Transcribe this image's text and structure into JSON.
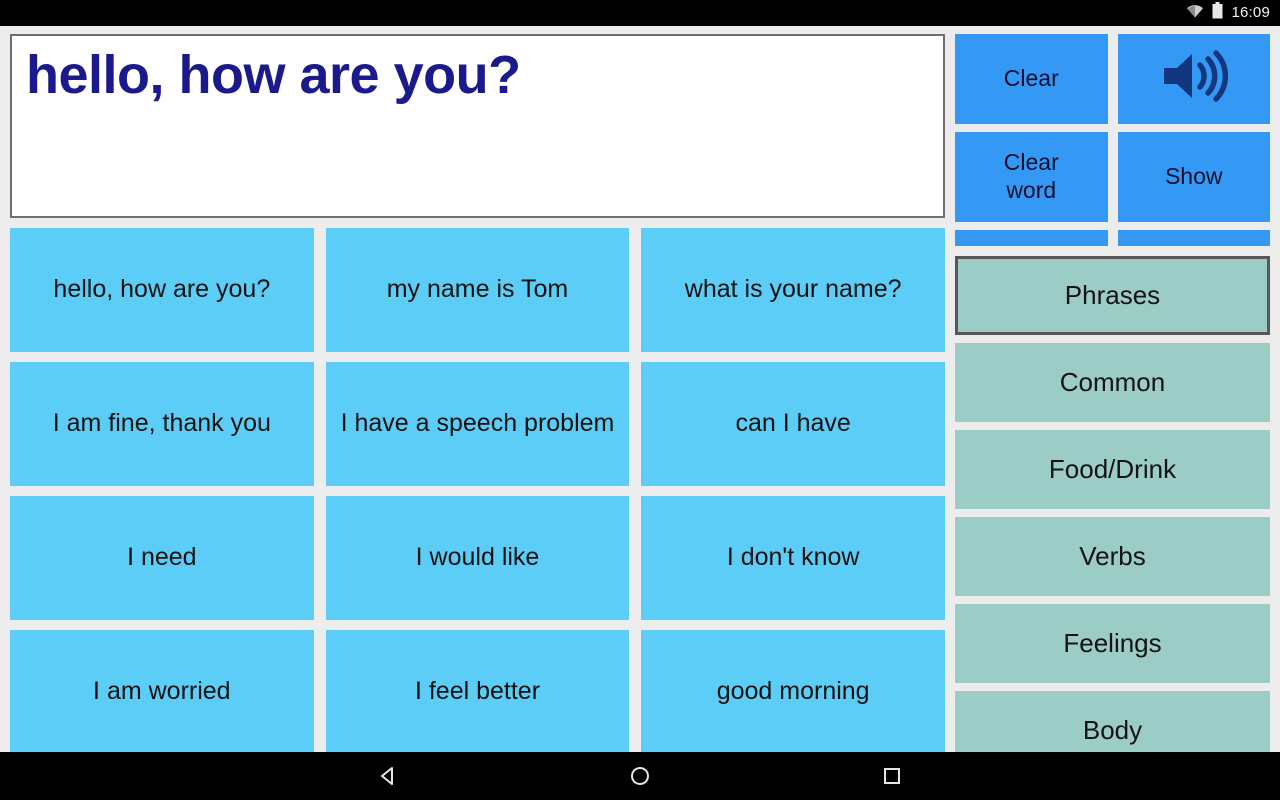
{
  "status_bar": {
    "time": "16:09",
    "icons": [
      "wifi-icon",
      "battery-icon"
    ]
  },
  "sentence_display": {
    "text": "hello, how are you?",
    "text_color": "#1a1a8c",
    "background": "#ffffff"
  },
  "actions": {
    "clear_label": "Clear",
    "speak_label": "speaker-icon",
    "clear_word_label": "Clear\nword",
    "clear_word_line1": "Clear",
    "clear_word_line2": "word",
    "show_label": "Show",
    "button_color": "#3399f5",
    "icon_color": "#12377f"
  },
  "categories": {
    "selected": "Phrases",
    "button_color": "#9bccc5",
    "selected_border_color": "#575757",
    "items": [
      {
        "label": "Phrases",
        "selected": true
      },
      {
        "label": "Common",
        "selected": false
      },
      {
        "label": "Food/Drink",
        "selected": false
      },
      {
        "label": "Verbs",
        "selected": false
      },
      {
        "label": "Feelings",
        "selected": false
      },
      {
        "label": "Body",
        "selected": false
      }
    ]
  },
  "phrases": {
    "tile_color": "#5ccdf7",
    "items": [
      {
        "label": "hello, how are you?"
      },
      {
        "label": "my name is Tom"
      },
      {
        "label": "what is your name?"
      },
      {
        "label": "I am fine, thank you"
      },
      {
        "label": "I have a speech problem"
      },
      {
        "label": "can I have"
      },
      {
        "label": "I need"
      },
      {
        "label": "I would like"
      },
      {
        "label": "I don't know"
      },
      {
        "label": "I am worried"
      },
      {
        "label": "I feel better"
      },
      {
        "label": "good morning"
      }
    ]
  },
  "nav_bar": {
    "back_label": "back-icon",
    "home_label": "home-icon",
    "recents_label": "recents-icon"
  }
}
